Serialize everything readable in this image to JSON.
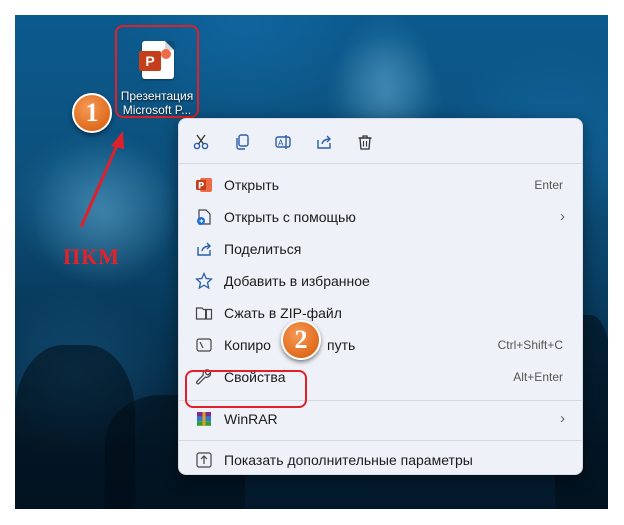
{
  "desktop_icon": {
    "line1": "Презентация",
    "line2": "Microsoft P...",
    "badge_letter": "P"
  },
  "annotations": {
    "step1": "1",
    "step2": "2",
    "pkm": "ПКМ",
    "accent_color": "#e0202a",
    "step_color": "#e06b1c"
  },
  "toolbar": [
    "cut-icon",
    "copy-icon",
    "rename-icon",
    "share-icon",
    "delete-icon"
  ],
  "menu": {
    "open": {
      "label": "Открыть",
      "shortcut": "Enter"
    },
    "open_with": {
      "label": "Открыть с помощью"
    },
    "share": {
      "label": "Поделиться"
    },
    "favorites": {
      "label": "Добавить в избранное"
    },
    "zip": {
      "label": "Сжать в ZIP-файл"
    },
    "copy_path": {
      "label": "Копировать как путь",
      "label_visible": "Копиро",
      "label_visible_end": "путь",
      "shortcut": "Ctrl+Shift+C"
    },
    "properties": {
      "label": "Свойства",
      "shortcut": "Alt+Enter"
    },
    "winrar": {
      "label": "WinRAR"
    },
    "more_options": {
      "label": "Показать дополнительные параметры"
    }
  }
}
